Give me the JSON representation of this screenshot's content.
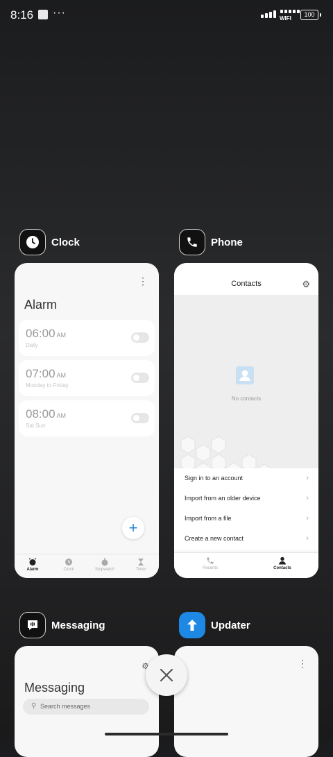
{
  "status_bar": {
    "time": "8:16",
    "wifi_label": "WIFI",
    "battery": "100"
  },
  "apps": [
    {
      "name": "Clock",
      "icon": "clock-icon"
    },
    {
      "name": "Phone",
      "icon": "phone-icon"
    },
    {
      "name": "Messaging",
      "icon": "message-icon"
    },
    {
      "name": "Updater",
      "icon": "up-arrow-icon"
    }
  ],
  "clock": {
    "title": "Alarm",
    "alarms": [
      {
        "time": "06:00",
        "ampm": "AM",
        "repeat": "Daily"
      },
      {
        "time": "07:00",
        "ampm": "AM",
        "repeat": "Monday to Friday"
      },
      {
        "time": "08:00",
        "ampm": "AM",
        "repeat": "Sat Sun"
      }
    ],
    "fab": "+",
    "tabs": [
      "Alarm",
      "Clock",
      "Stopwatch",
      "Timer"
    ]
  },
  "phone": {
    "title": "Contacts",
    "empty_text": "No contacts",
    "options": [
      "Sign in to an account",
      "Import from an older device",
      "Import from a file",
      "Create a new contact"
    ],
    "tabs": [
      "Recents",
      "Contacts"
    ]
  },
  "messaging": {
    "title": "Messaging",
    "search_placeholder": "Search messages"
  },
  "colors": {
    "accent": "#2b82d9",
    "updater_icon": "#1e88e5"
  }
}
